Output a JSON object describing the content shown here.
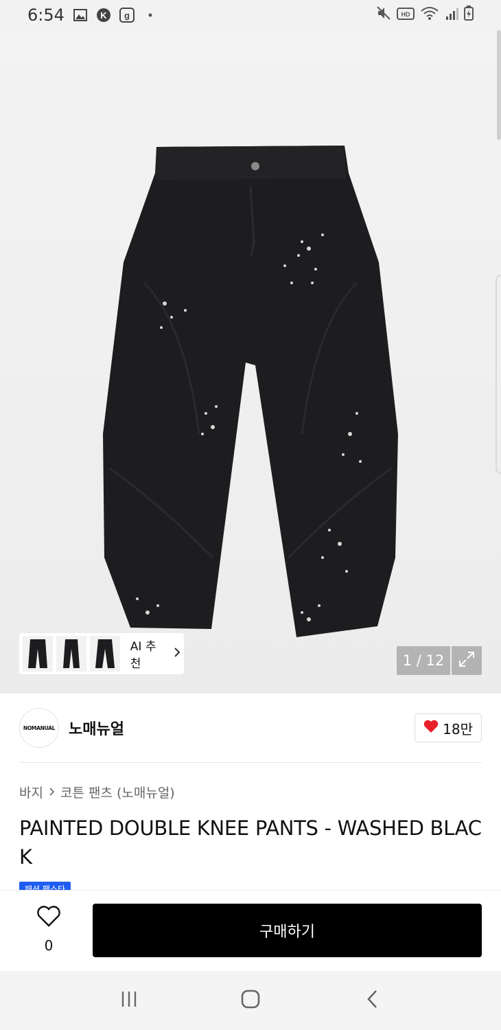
{
  "status": {
    "time": "6:54"
  },
  "gallery": {
    "ai_label": "AI 추천",
    "counter": "1 / 12",
    "thumbnail_count": 3
  },
  "brand": {
    "logo_text": "NOMANUAL",
    "name": "노매뉴얼",
    "likes": "18만"
  },
  "breadcrumb": {
    "category": "바지",
    "subcategory": "코튼 팬츠 (노매뉴얼)"
  },
  "product": {
    "title": "PAINTED DOUBLE KNEE PANTS - WASHED BLACK",
    "badge": "패션 팬스타"
  },
  "bottom": {
    "wish_count": "0",
    "buy_label": "구매하기"
  },
  "colors": {
    "heart": "#e8202a",
    "buy_button": "#000000",
    "badge": "#1f5cf2"
  },
  "icons": [
    "gallery-icon",
    "k-app-icon",
    "g-app-icon",
    "mute-icon",
    "hd-icon",
    "wifi-icon",
    "signal-icon",
    "battery-icon",
    "heart-icon",
    "expand-icon",
    "chevron-right-icon",
    "recents-icon",
    "home-icon",
    "back-icon"
  ]
}
